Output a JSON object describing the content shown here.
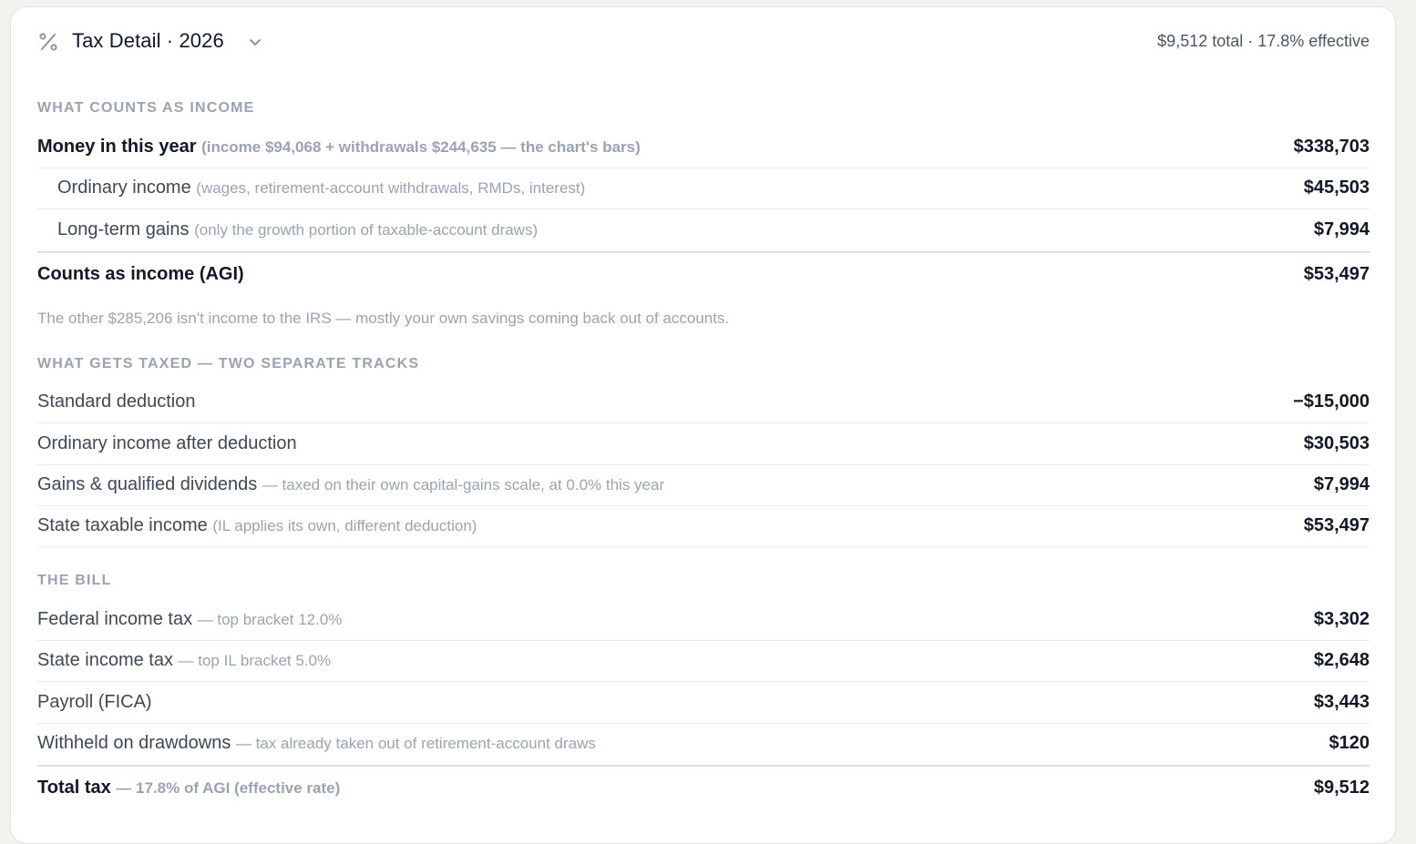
{
  "header": {
    "icon": "percent-icon",
    "title": "Tax Detail · 2026",
    "summary": "$9,512 total · 17.8% effective"
  },
  "sections": {
    "income": {
      "label": "WHAT COUNTS AS INCOME"
    },
    "taxed": {
      "label": "WHAT GETS TAXED — TWO SEPARATE TRACKS"
    },
    "bill": {
      "label": "THE BILL"
    }
  },
  "income_rows": [
    {
      "label": "Money in this year",
      "note": "(income $94,068 + withdrawals $244,635 — the chart's bars)",
      "value": "$338,703"
    },
    {
      "label": "Ordinary income",
      "note": "(wages, retirement-account withdrawals, RMDs, interest)",
      "value": "$45,503"
    },
    {
      "label": "Long-term gains",
      "note": "(only the growth portion of taxable-account draws)",
      "value": "$7,994"
    },
    {
      "label": "Counts as income (AGI)",
      "note": "",
      "value": "$53,497"
    }
  ],
  "income_footnote": "The other $285,206 isn't income to the IRS — mostly your own savings coming back out of accounts.",
  "taxed_rows": [
    {
      "label": "Standard deduction",
      "note": "",
      "value": "−$15,000"
    },
    {
      "label": "Ordinary income after deduction",
      "note": "",
      "value": "$30,503"
    },
    {
      "label": "Gains & qualified dividends",
      "note": "— taxed on their own capital-gains scale, at 0.0% this year",
      "value": "$7,994"
    },
    {
      "label": "State taxable income",
      "note": "(IL applies its own, different deduction)",
      "value": "$53,497"
    }
  ],
  "bill_rows": [
    {
      "label": "Federal income tax",
      "note": "— top bracket 12.0%",
      "value": "$3,302"
    },
    {
      "label": "State income tax",
      "note": "— top IL bracket 5.0%",
      "value": "$2,648"
    },
    {
      "label": "Payroll (FICA)",
      "note": "",
      "value": "$3,443"
    },
    {
      "label": "Withheld on drawdowns",
      "note": "— tax already taken out of retirement-account draws",
      "value": "$120"
    },
    {
      "label": "Total tax",
      "note": "— 17.8% of AGI (effective rate)",
      "value": "$9,512"
    }
  ]
}
